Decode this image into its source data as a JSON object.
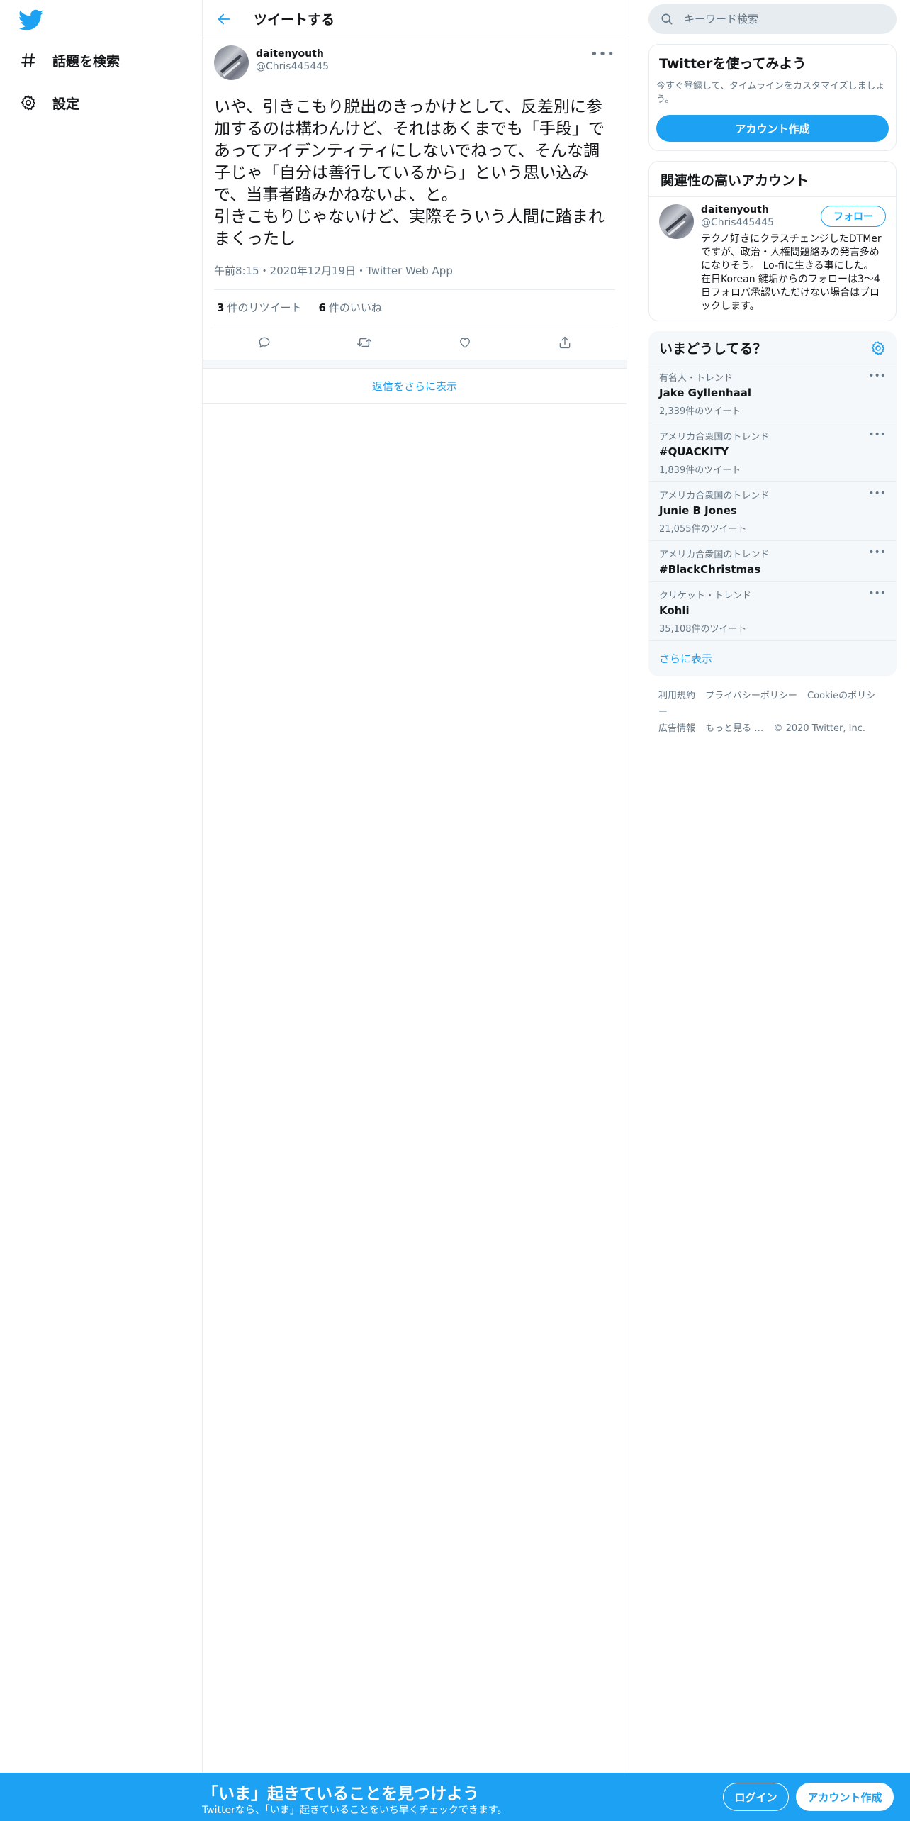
{
  "nav": {
    "logo_icon": "twitter-bird-icon",
    "items": [
      {
        "label": "話題を検索",
        "icon": "hashtag-icon"
      },
      {
        "label": "設定",
        "icon": "gear-icon"
      }
    ]
  },
  "header": {
    "title": "ツイートする"
  },
  "tweet": {
    "author_name": "daitenyouth",
    "author_handle": "@Chris445445",
    "text": "いや、引きこもり脱出のきっかけとして、反差別に参加するのは構わんけど、それはあくまでも「手段」であってアイデンティティにしないでねって、そんな調子じゃ「自分は善行しているから」という思い込みで、当事者踏みかねないよ、と。\n引きこもりじゃないけど、実際そういう人間に踏まれまくったし",
    "meta": "午前8:15・2020年12月19日・Twitter Web App",
    "retweets_num": "3",
    "retweets_label": "件のリツイート",
    "likes_num": "6",
    "likes_label": "件のいいね"
  },
  "show_more_replies": "返信をさらに表示",
  "search": {
    "placeholder": "キーワード検索"
  },
  "signup_card": {
    "title": "Twitterを使ってみよう",
    "subtitle": "今すぐ登録して、タイムラインをカスタマイズしましょう。",
    "button": "アカウント作成"
  },
  "related": {
    "title": "関連性の高いアカウント",
    "name": "daitenyouth",
    "handle": "@Chris445445",
    "bio": "テクノ好きにクラスチェンジしたDTMerですが、政治・人権問題絡みの発言多めになりそう。 Lo-fiに生きる事にした。 在日Korean 鍵垢からのフォローは3～4日フォロバ承認いただけない場合はブロックします。",
    "follow": "フォロー"
  },
  "trends": {
    "title": "いまどうしてる？",
    "items": [
      {
        "context": "有名人・トレンド",
        "name": "Jake Gyllenhaal",
        "count": "2,339件のツイート"
      },
      {
        "context": "アメリカ合衆国のトレンド",
        "name": "#QUACKITY",
        "count": "1,839件のツイート"
      },
      {
        "context": "アメリカ合衆国のトレンド",
        "name": "Junie B Jones",
        "count": "21,055件のツイート"
      },
      {
        "context": "アメリカ合衆国のトレンド",
        "name": "#BlackChristmas",
        "count": ""
      },
      {
        "context": "クリケット・トレンド",
        "name": "Kohli",
        "count": "35,108件のツイート"
      }
    ],
    "show_more": "さらに表示"
  },
  "footer": {
    "links": [
      "利用規約",
      "プライバシーポリシー",
      "Cookieのポリシー",
      "広告情報",
      "もっと見る …"
    ],
    "copyright": "© 2020 Twitter, Inc."
  },
  "bottom_bar": {
    "title": "「いま」起きていることを見つけよう",
    "subtitle": "Twitterなら、「いま」起きていることをいち早くチェックできます。",
    "login": "ログイン",
    "signup": "アカウント作成"
  },
  "colors": {
    "accent": "#1da1f2",
    "secondary_text": "#657786",
    "border": "#e6ecf0"
  }
}
